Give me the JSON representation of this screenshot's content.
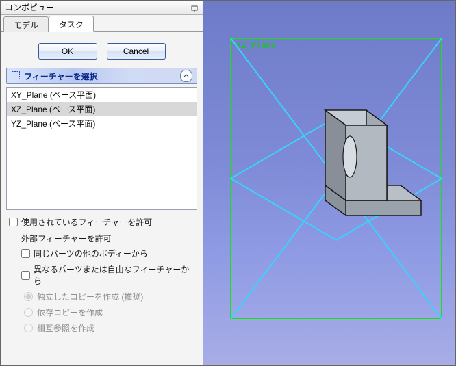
{
  "panel": {
    "title": "コンボビュー",
    "tabs": {
      "model": "モデル",
      "task": "タスク",
      "active": "task"
    },
    "buttons": {
      "ok": "OK",
      "cancel": "Cancel"
    },
    "section": {
      "title": "フィーチャーを選択"
    },
    "features": {
      "items": [
        {
          "label": "XY_Plane (ベース平面)"
        },
        {
          "label": "XZ_Plane (ベース平面)"
        },
        {
          "label": "YZ_Plane (ベース平面)"
        }
      ],
      "selected_index": 1
    },
    "options": {
      "allow_used_features": "使用されているフィーチャーを許可",
      "allow_external": "外部フィーチャーを許可",
      "same_part_other_body": "同じパーツの他のボディーから",
      "different_part_or_free": "異なるパーツまたは自由なフィーチャーから",
      "radio_independent": "独立したコピーを作成 (推奨)",
      "radio_dependent": "依存コピーを作成",
      "radio_crossref": "相互参照を作成"
    }
  },
  "viewport": {
    "visible_plane_label": "XZ_Plane"
  }
}
